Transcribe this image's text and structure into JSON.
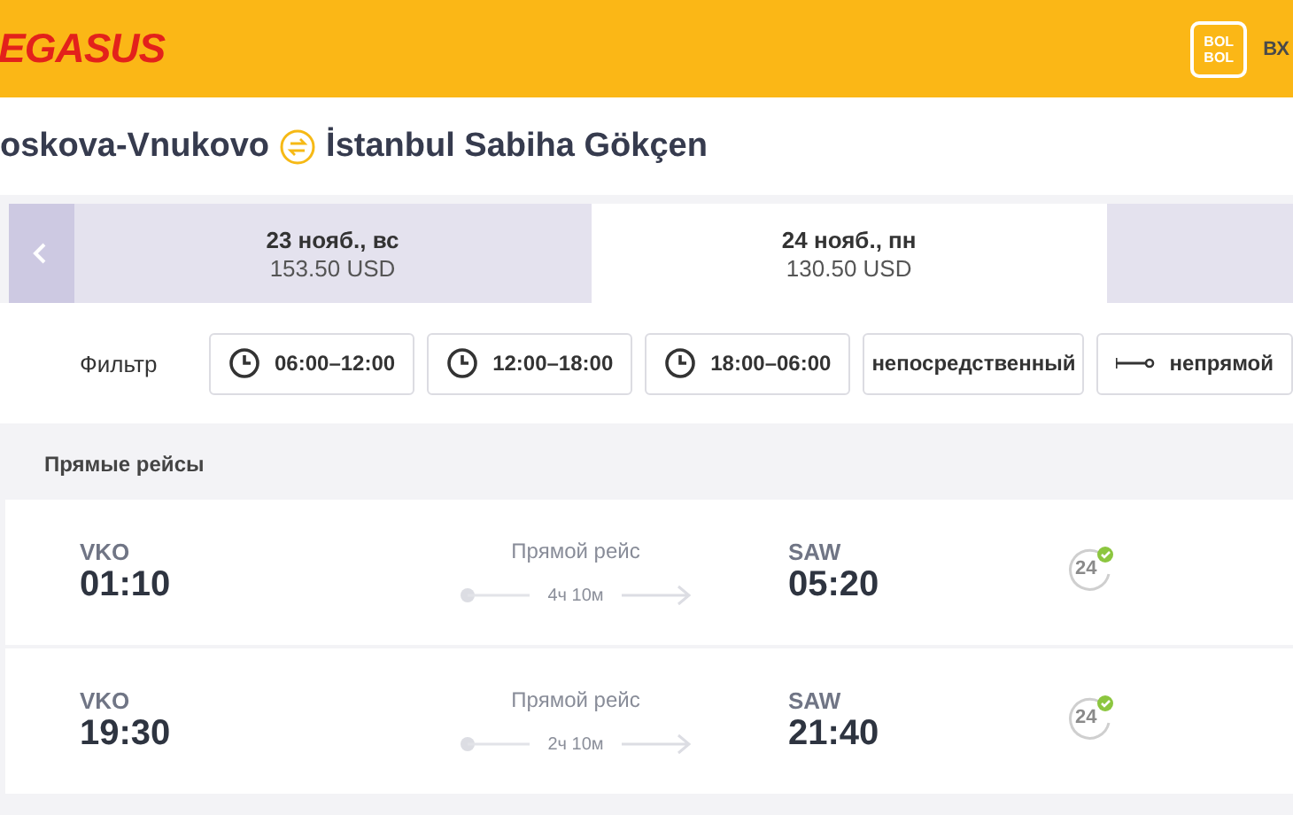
{
  "header": {
    "logo": "EGASUS",
    "badge_lines": [
      "BOL",
      "BOL"
    ],
    "login": "ВХ"
  },
  "route": {
    "origin": "oskova-Vnukovo",
    "destination": "İstanbul Sabiha Gökçen"
  },
  "date_tabs": [
    {
      "date": "23 нояб., вс",
      "price": "153.50 USD",
      "selected": false
    },
    {
      "date": "24 нояб., пн",
      "price": "130.50 USD",
      "selected": true
    },
    {
      "selected": false
    }
  ],
  "filter": {
    "label": "Фильтр",
    "options": [
      {
        "kind": "time",
        "label": "06:00–12:00"
      },
      {
        "kind": "time",
        "label": "12:00–18:00"
      },
      {
        "kind": "time",
        "label": "18:00–06:00"
      },
      {
        "kind": "plain",
        "label": "непосредственный"
      },
      {
        "kind": "stop",
        "label": "непрямой"
      }
    ]
  },
  "section_title": "Прямые рейсы",
  "flights": [
    {
      "from": "VKO",
      "dep": "01:10",
      "type": "Прямой рейс",
      "duration": "4ч 10м",
      "to": "SAW",
      "arr": "05:20",
      "icon_label": "24"
    },
    {
      "from": "VKO",
      "dep": "19:30",
      "type": "Прямой рейс",
      "duration": "2ч 10м",
      "to": "SAW",
      "arr": "21:40",
      "icon_label": "24"
    }
  ]
}
